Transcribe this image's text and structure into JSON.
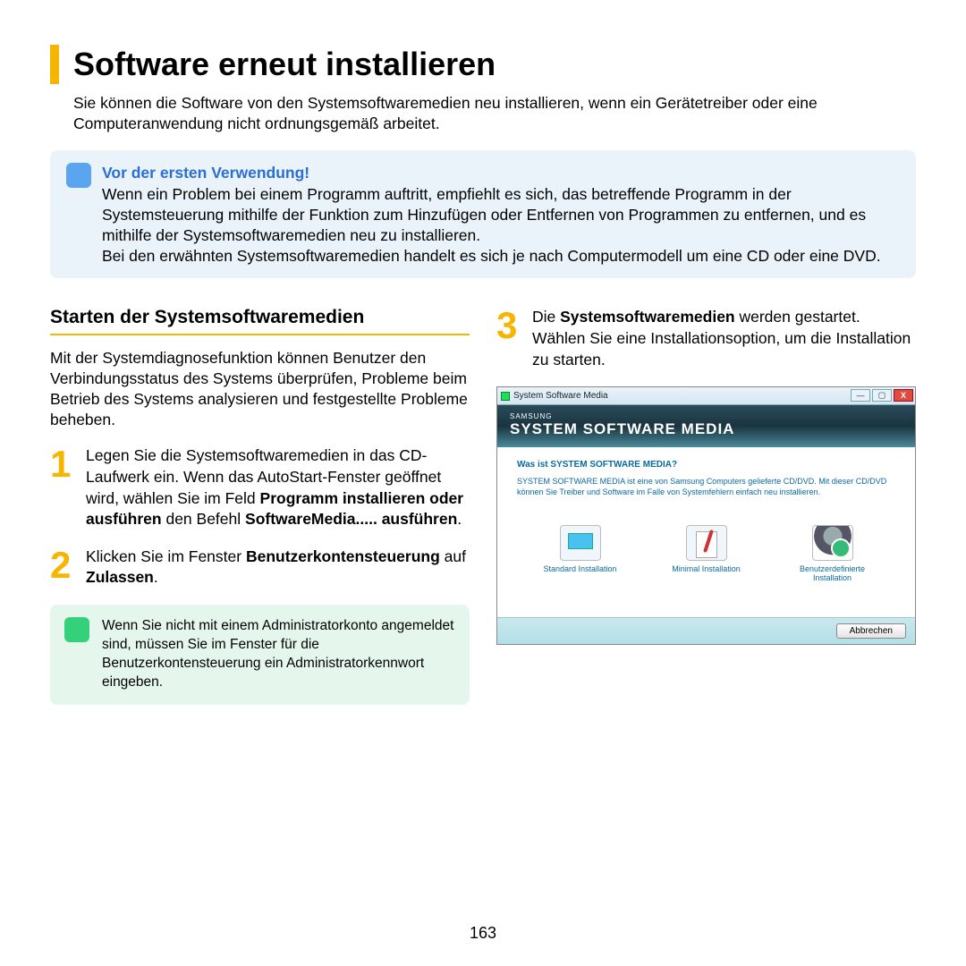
{
  "title": "Software erneut installieren",
  "intro": "Sie können die Software von den Systemsoftwaremedien neu installieren, wenn ein Gerätetreiber oder eine Computeranwendung nicht ordnungsgemäß arbeitet.",
  "info": {
    "heading": "Vor der ersten Verwendung!",
    "p1": "Wenn ein Problem bei einem Programm auftritt, empfiehlt es sich, das betreffende Programm in der Systemsteuerung mithilfe der Funktion zum Hinzufügen oder Entfernen von Programmen zu entfernen, und es mithilfe der Systemsoftwaremedien neu zu installieren.",
    "p2": "Bei den erwähnten Systemsoftwaremedien handelt es sich je nach Computermodell um eine CD oder eine DVD."
  },
  "left": {
    "heading": "Starten der Systemsoftwaremedien",
    "para": "Mit der Systemdiagnosefunktion können Benutzer den Verbindungsstatus des Systems überprüfen, Probleme beim Betrieb des Systems analysieren und festgestellte Probleme beheben."
  },
  "steps": {
    "s1_a": "Legen Sie die Systemsoftwaremedien in das CD-Laufwerk ein. Wenn das AutoStart-Fenster geöffnet wird, wählen Sie im Feld ",
    "s1_b1": "Programm installieren oder ausführen",
    "s1_c": " den Befehl ",
    "s1_b2": "SoftwareMedia..... ausführen",
    "s1_d": ".",
    "s2_a": "Klicken Sie im Fenster ",
    "s2_b1": "Benutzerkontensteuerung",
    "s2_c": " auf ",
    "s2_b2": "Zulassen",
    "s2_d": ".",
    "s3_a": "Die ",
    "s3_b1": "Systemsoftwaremedien",
    "s3_c": " werden gestartet. Wählen Sie eine Installationsoption, um die Installation zu starten."
  },
  "note": "Wenn Sie nicht mit einem Administratorkonto angemeldet sind, müssen Sie im Fenster für die Benutzerkontensteuerung ein Administratorkennwort eingeben.",
  "screenshot": {
    "titlebar": "System Software Media",
    "brand": "SAMSUNG",
    "header": "SYSTEM SOFTWARE MEDIA",
    "question": "Was ist SYSTEM SOFTWARE MEDIA?",
    "desc": "SYSTEM SOFTWARE MEDIA ist eine von Samsung Computers gelieferte CD/DVD.\nMit dieser CD/DVD können Sie Treiber und Software im Falle von Systemfehlern einfach neu installieren.",
    "opt1": "Standard Installation",
    "opt2": "Minimal Installation",
    "opt3": "Benutzerdefinierte Installation",
    "cancel": "Abbrechen"
  },
  "page_number": "163"
}
